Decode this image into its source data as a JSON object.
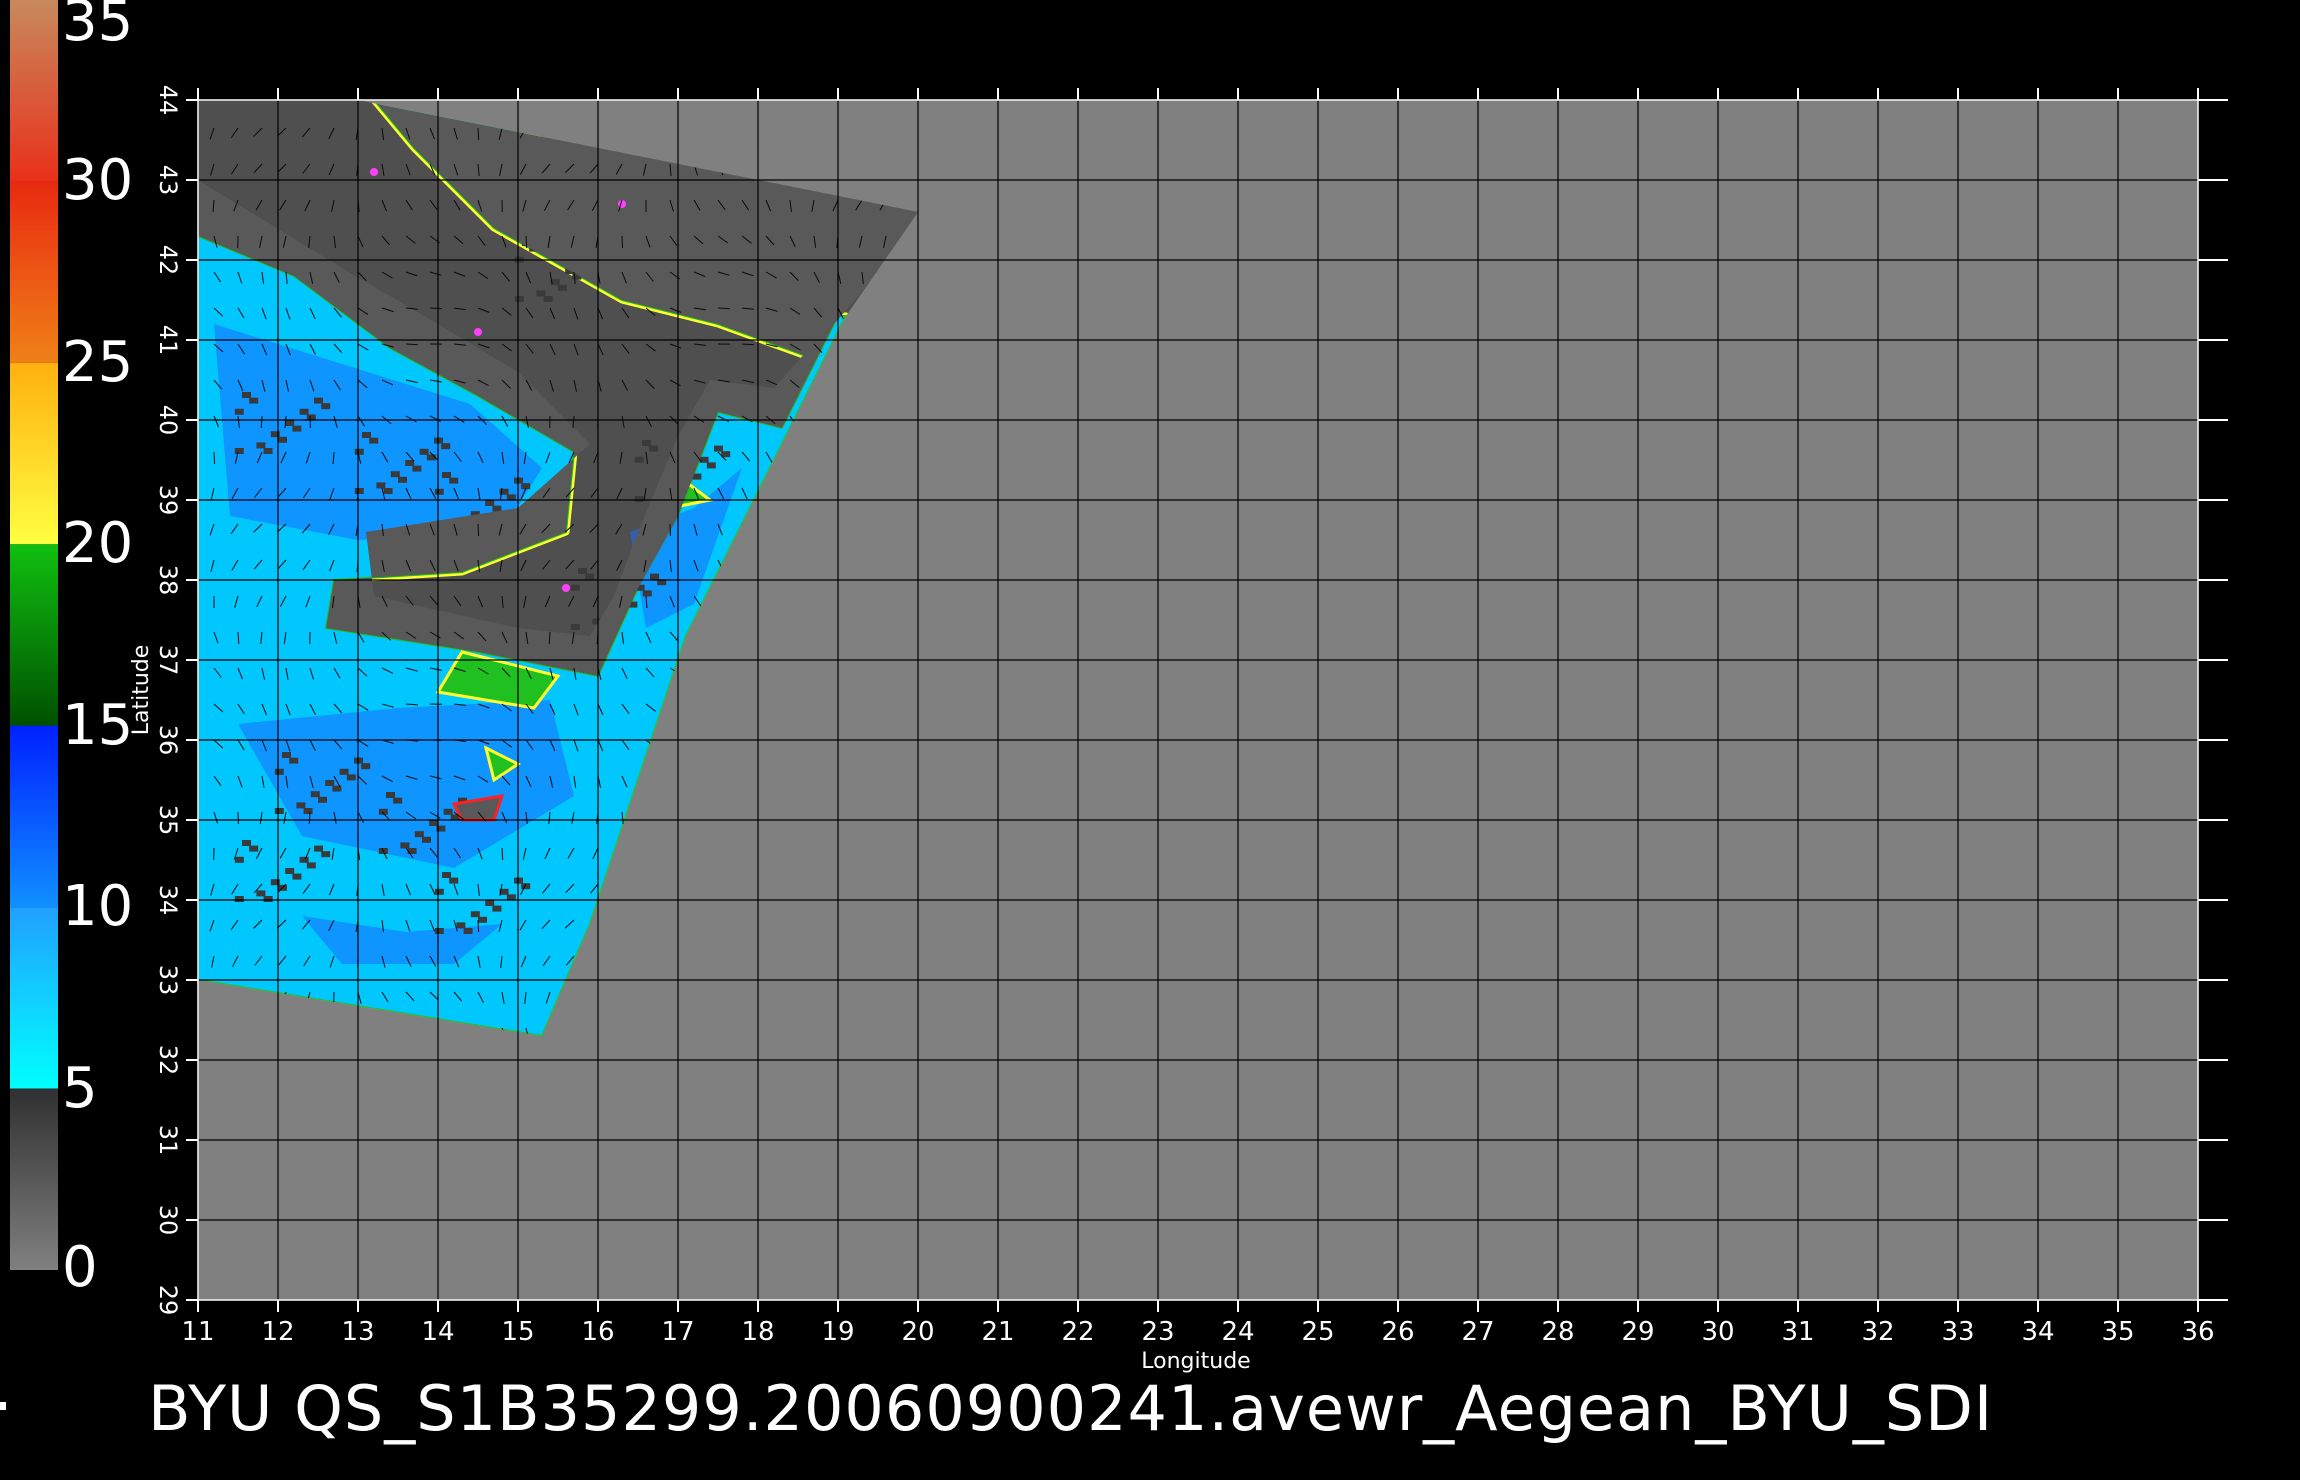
{
  "colorbar": {
    "labels": [
      "35",
      "30",
      "25",
      "20",
      "15",
      "10",
      "5",
      "0"
    ],
    "values": [
      35,
      30,
      25,
      20,
      15,
      10,
      5,
      0
    ],
    "segments": [
      {
        "from": 30,
        "to": 35,
        "colors": [
          "#e9301a",
          "#c8895c"
        ]
      },
      {
        "from": 25,
        "to": 30,
        "colors": [
          "#f08018",
          "#e82a10"
        ]
      },
      {
        "from": 20,
        "to": 25,
        "colors": [
          "#ffff40",
          "#ffb010"
        ]
      },
      {
        "from": 15,
        "to": 20,
        "colors": [
          "#005000",
          "#10c010"
        ]
      },
      {
        "from": 10,
        "to": 15,
        "colors": [
          "#1090ff",
          "#0020ff"
        ]
      },
      {
        "from": 5,
        "to": 10,
        "colors": [
          "#00ffff",
          "#20a0ff"
        ]
      },
      {
        "from": 0,
        "to": 5,
        "colors": [
          "#808080",
          "#303030"
        ]
      }
    ]
  },
  "map": {
    "x_axis_label": "Longitude",
    "y_axis_label": "Latitude",
    "x_ticks": [
      "11",
      "12",
      "13",
      "14",
      "15",
      "16",
      "17",
      "18",
      "19",
      "20",
      "21",
      "22",
      "23",
      "24",
      "25",
      "26",
      "27",
      "28",
      "29",
      "30",
      "31",
      "32",
      "33",
      "34",
      "35",
      "36"
    ],
    "y_ticks": [
      "29",
      "30",
      "31",
      "32",
      "33",
      "34",
      "35",
      "36",
      "37",
      "38",
      "39",
      "40",
      "41",
      "42",
      "43",
      "44"
    ],
    "lon_range": [
      11,
      36
    ],
    "lat_range": [
      29,
      44
    ],
    "grid": true,
    "colors": {
      "background": "#808080",
      "swath": "#4f4f4f",
      "land": "#595959",
      "wind_low": "#00c8ff",
      "wind_mid": "#1a6cff",
      "coast_green": "#20c020",
      "coast_yellow": "#ffff30",
      "coast_red": "#ff2020",
      "coast_magenta": "#ff40ff"
    }
  },
  "caption": "BYU  QS_S1B35299.20060900241.avewr_Aegean_BYU_SDI"
}
